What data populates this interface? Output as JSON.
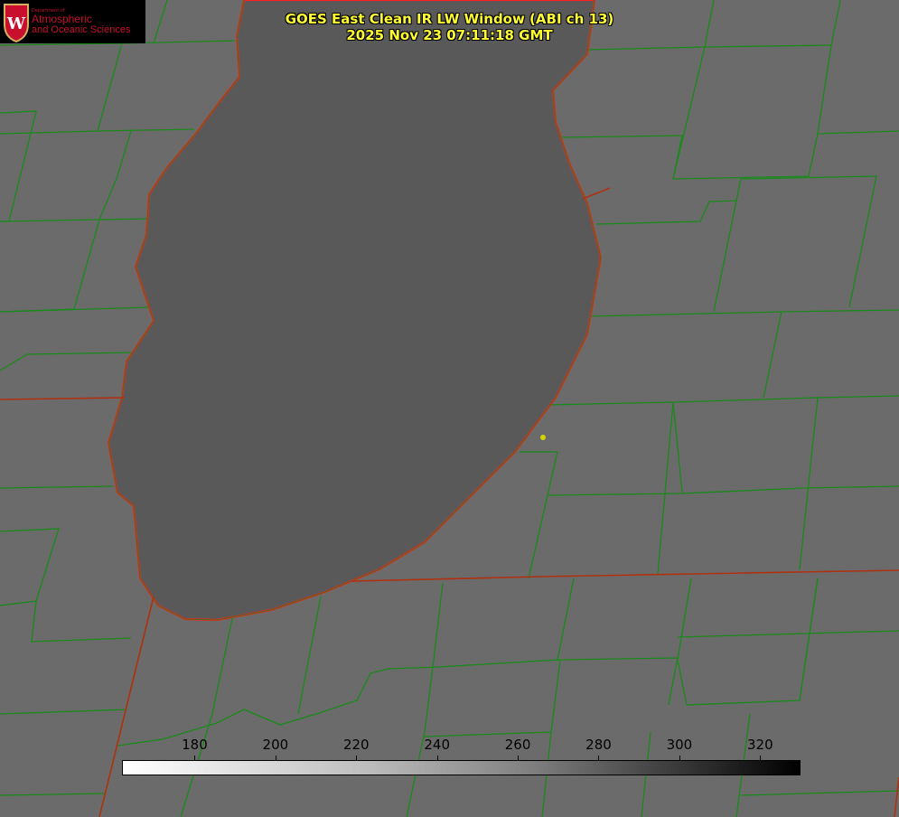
{
  "title": {
    "line1": "GOES East Clean IR LW Window (ABI ch 13)",
    "line2": "2025 Nov 23 07:11:18 GMT"
  },
  "logo": {
    "department": "Department of",
    "line1": "Atmospheric",
    "line2": "and Oceanic Sciences",
    "emblem": "W"
  },
  "colorbar": {
    "min": 162,
    "max": 330,
    "ticks": [
      "180",
      "200",
      "220",
      "240",
      "260",
      "280",
      "300",
      "320"
    ],
    "tick_values": [
      180,
      200,
      220,
      240,
      260,
      280,
      300,
      320
    ]
  },
  "colors": {
    "title": "#ffff33",
    "coast": "#ff2020",
    "borders": "#1a8a1a",
    "lake": "#595959",
    "land": "#6b6b6b"
  }
}
